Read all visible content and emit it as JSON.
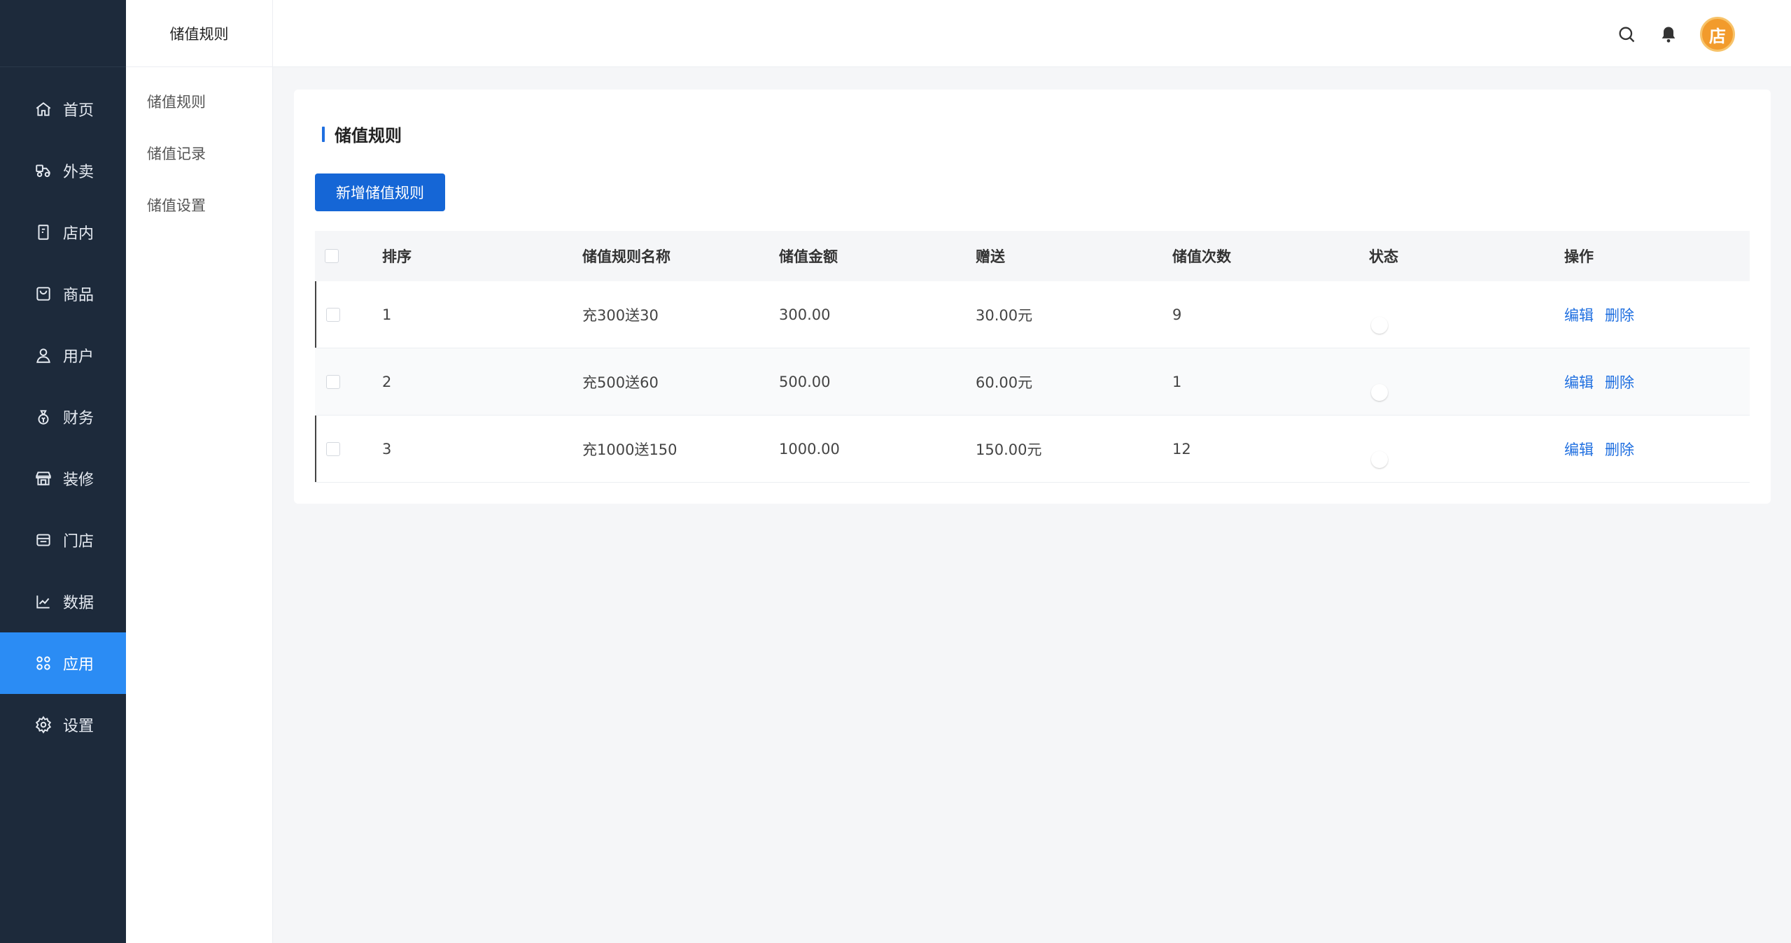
{
  "nav": {
    "items": [
      {
        "label": "首页",
        "icon": "home-icon"
      },
      {
        "label": "外卖",
        "icon": "delivery-icon"
      },
      {
        "label": "店内",
        "icon": "store-inside-icon"
      },
      {
        "label": "商品",
        "icon": "bag-icon"
      },
      {
        "label": "用户",
        "icon": "user-icon"
      },
      {
        "label": "财务",
        "icon": "money-bag-icon"
      },
      {
        "label": "装修",
        "icon": "shop-decor-icon"
      },
      {
        "label": "门店",
        "icon": "store-icon"
      },
      {
        "label": "数据",
        "icon": "chart-icon"
      },
      {
        "label": "应用",
        "icon": "apps-icon",
        "active": true
      },
      {
        "label": "设置",
        "icon": "gear-icon"
      }
    ]
  },
  "subnav": {
    "title": "储值规则",
    "items": [
      {
        "label": "储值规则"
      },
      {
        "label": "储值记录"
      },
      {
        "label": "储值设置"
      }
    ]
  },
  "header": {
    "icons": [
      "search-icon",
      "bell-icon"
    ],
    "avatar_text": "店"
  },
  "main": {
    "title": "储值规则",
    "add_button": "新增储值规则",
    "columns": [
      "排序",
      "储值规则名称",
      "储值金额",
      "赠送",
      "储值次数",
      "状态",
      "操作"
    ],
    "rows": [
      {
        "sort": "1",
        "name": "充300送30",
        "amount": "300.00",
        "gift": "30.00元",
        "count": "9",
        "enabled": false
      },
      {
        "sort": "2",
        "name": "充500送60",
        "amount": "500.00",
        "gift": "60.00元",
        "count": "1",
        "enabled": false
      },
      {
        "sort": "3",
        "name": "充1000送150",
        "amount": "1000.00",
        "gift": "150.00元",
        "count": "12",
        "enabled": false
      }
    ],
    "actions": {
      "edit": "编辑",
      "delete": "删除"
    }
  },
  "colors": {
    "nav_bg": "#1d2a3b",
    "nav_active": "#2b8cf4",
    "primary": "#1566d6",
    "link": "#1f6fe0"
  }
}
